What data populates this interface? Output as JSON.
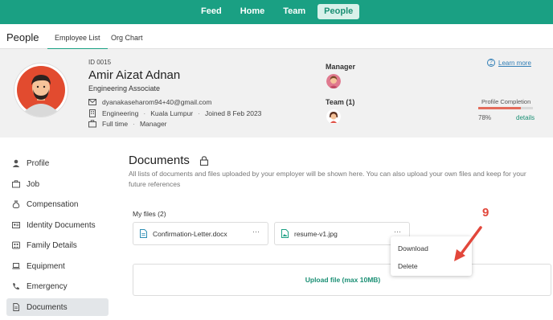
{
  "nav": {
    "items": [
      "Feed",
      "Home",
      "Team",
      "People"
    ],
    "active": "People"
  },
  "subheader": {
    "title": "People",
    "tabs": [
      "Employee List",
      "Org Chart"
    ],
    "active_tab": "Employee List"
  },
  "profile": {
    "id": "ID 0015",
    "name": "Amir Aizat Adnan",
    "role": "Engineering Associate",
    "email": "dyanakaseharom94+40@gmail.com",
    "department": "Engineering",
    "location": "Kuala Lumpur",
    "joined": "Joined 8 Feb 2023",
    "employment_type": "Full time",
    "level": "Manager",
    "manager_label": "Manager",
    "team_label": "Team (1)",
    "learn_more": "Learn more",
    "completion_label": "Profile Completion",
    "completion_percent": 78,
    "completion_text": "78%",
    "details_link": "details"
  },
  "sidebar": {
    "items": [
      {
        "label": "Profile",
        "icon": "person-icon"
      },
      {
        "label": "Job",
        "icon": "briefcase-icon"
      },
      {
        "label": "Compensation",
        "icon": "money-bag-icon"
      },
      {
        "label": "Identity Documents",
        "icon": "id-card-icon"
      },
      {
        "label": "Family Details",
        "icon": "family-icon"
      },
      {
        "label": "Equipment",
        "icon": "laptop-icon"
      },
      {
        "label": "Emergency",
        "icon": "phone-icon"
      },
      {
        "label": "Documents",
        "icon": "document-icon"
      }
    ],
    "active": "Documents"
  },
  "documents": {
    "title": "Documents",
    "description": "All lists of documents and files uploaded by your employer will be shown here. You can also upload your own files and keep for your future references",
    "my_files_label": "My files (2)",
    "files": [
      {
        "name": "Confirmation-Letter.docx",
        "type": "docx"
      },
      {
        "name": "resume-v1.jpg",
        "type": "jpg"
      }
    ],
    "more_label": "···",
    "menu": [
      "Download",
      "Delete"
    ],
    "upload_label": "Upload file (max 10MB)"
  },
  "annotation": {
    "step": "9",
    "color": "#e2473b"
  },
  "colors": {
    "brand": "#1aa083",
    "progress": "#e36b5a",
    "link": "#2f7db5"
  }
}
